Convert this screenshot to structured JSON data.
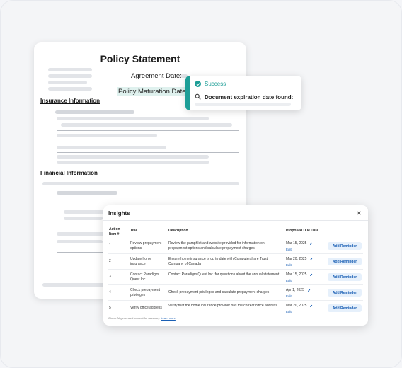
{
  "document": {
    "title": "Policy Statement",
    "agreement_date_label": "Agreement Date:",
    "maturation_date_label": "Policy Maturation Date:",
    "section_insurance": "Insurance Information",
    "section_financial": "Financial Information"
  },
  "toast": {
    "status": "Success",
    "message": "Document expiration date found:"
  },
  "insights": {
    "title": "Insights",
    "columns": {
      "num": "Action Item #",
      "title": "Title",
      "description": "Description",
      "due": "Proposed Due Date"
    },
    "rows": [
      {
        "num": "1",
        "title": "Review prepayment options",
        "description": "Review the pamphlet and website provided for information on prepayment options and calculate prepayment charges",
        "due": "Mar 15, 2025",
        "edit": "Edit",
        "action": "Add Reminder"
      },
      {
        "num": "2",
        "title": "Update home insurance",
        "description": "Ensure home insurance is up to date with Computershare Trust Company of Canada",
        "due": "Mar 20, 2025",
        "edit": "Edit",
        "action": "Add Reminder"
      },
      {
        "num": "3",
        "title": "Contact Paradigm Quest Inc.",
        "description": "Contact Paradigm Quest Inc. for questions about the annual statement",
        "due": "Mar 15, 2025",
        "edit": "Edit",
        "action": "Add Reminder"
      },
      {
        "num": "4",
        "title": "Check prepayment privileges",
        "description": "Check prepayment privileges and calculate prepayment charges",
        "due": "Apr 1, 2025",
        "edit": "Edit",
        "action": "Add Reminder"
      },
      {
        "num": "5",
        "title": "Verify office address",
        "description": "Verify that the home insurance provider has the correct office address",
        "due": "Mar 20, 2025",
        "edit": "Edit",
        "action": "Add Reminder"
      }
    ],
    "footer_note": "Check AI-generated content for accuracy.",
    "learn_more": "Learn more"
  },
  "colors": {
    "accent": "#1d9e97",
    "link": "#1a5fb4"
  }
}
